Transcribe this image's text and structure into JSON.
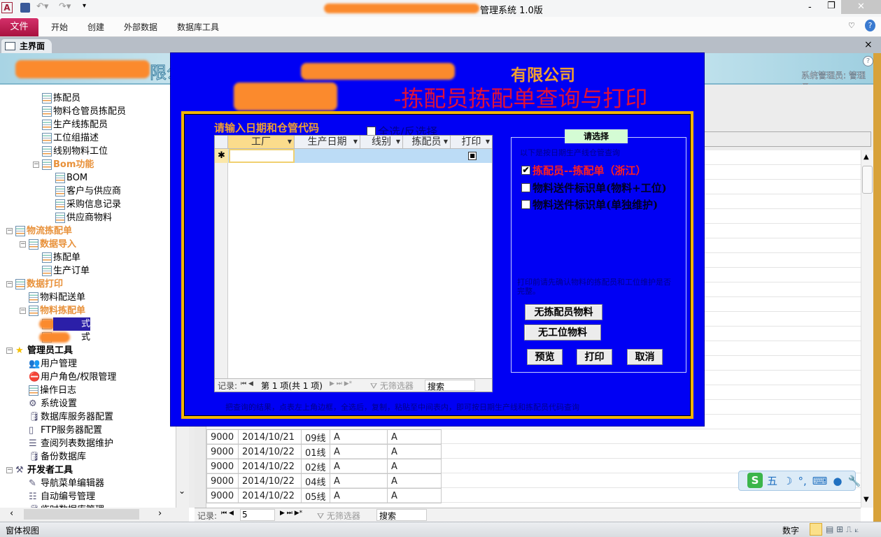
{
  "window": {
    "title": "管理系统 1.0版",
    "min": "-",
    "max": "❐",
    "close": "✕"
  },
  "ribbon": {
    "file": "文件",
    "tabs": [
      "开始",
      "创建",
      "外部数据",
      "数据库工具"
    ]
  },
  "doc_tab": {
    "label": "主界面",
    "close": "×"
  },
  "banner": {
    "company_suffix": "限公",
    "user": "系统管理员: 管理员"
  },
  "nav": [
    {
      "label": "拣配员",
      "level": 3
    },
    {
      "label": "物料仓管员拣配员",
      "level": 3
    },
    {
      "label": "生产线拣配员",
      "level": 3
    },
    {
      "label": "工位组描述",
      "level": 3
    },
    {
      "label": "线别物料工位",
      "level": 3
    },
    {
      "label": "Bom功能",
      "level": 3,
      "group": true
    },
    {
      "label": "BOM",
      "level": 4
    },
    {
      "label": "客户与供应商",
      "level": 4
    },
    {
      "label": "采购信息记录",
      "level": 4
    },
    {
      "label": "供应商物料",
      "level": 4
    },
    {
      "label": "物流拣配单",
      "level": 1,
      "group": true
    },
    {
      "label": "数据导入",
      "level": 2,
      "group": true
    },
    {
      "label": "拣配单",
      "level": 3
    },
    {
      "label": "生产订单",
      "level": 3
    },
    {
      "label": "数据打印",
      "level": 1,
      "group": true
    },
    {
      "label": "物料配送单",
      "level": 2
    },
    {
      "label": "物料拣配单",
      "level": 2,
      "group": true
    },
    {
      "label": "式",
      "level": 3,
      "selected": true,
      "redacted": true
    },
    {
      "label": "式",
      "level": 3,
      "redacted": true
    },
    {
      "label": "管理员工具",
      "level": 1,
      "bold": true,
      "icon": "star"
    },
    {
      "label": "用户管理",
      "level": 2,
      "icon": "users"
    },
    {
      "label": "用户角色/权限管理",
      "level": 2,
      "icon": "no-entry"
    },
    {
      "label": "操作日志",
      "level": 2
    },
    {
      "label": "系统设置",
      "level": 2,
      "icon": "settings"
    },
    {
      "label": "数据库服务器配置",
      "level": 2,
      "icon": "database"
    },
    {
      "label": "FTP服务器配置",
      "level": 2,
      "icon": "server"
    },
    {
      "label": "查阅列表数据维护",
      "level": 2,
      "icon": "list"
    },
    {
      "label": "备份数据库",
      "level": 2,
      "icon": "database"
    },
    {
      "label": "开发者工具",
      "level": 1,
      "bold": true,
      "icon": "tools"
    },
    {
      "label": "导航菜单编辑器",
      "level": 2,
      "icon": "edit"
    },
    {
      "label": "自动编号管理",
      "level": 2,
      "icon": "numbered-list"
    },
    {
      "label": "临时数据库管理",
      "level": 2,
      "icon": "database"
    }
  ],
  "background_grid": {
    "rows": [
      [
        "9000",
        "2014/10/21",
        "09线",
        "A",
        "A"
      ],
      [
        "9000",
        "2014/10/22",
        "01线",
        "A",
        "A"
      ],
      [
        "9000",
        "2014/10/22",
        "02线",
        "A",
        "A"
      ],
      [
        "9000",
        "2014/10/22",
        "04线",
        "A",
        "A"
      ],
      [
        "9000",
        "2014/10/22",
        "05线",
        "A",
        "A"
      ]
    ],
    "nav": {
      "label": "记录:",
      "current": "5",
      "filter": "无筛选器",
      "search": "搜索"
    }
  },
  "popup": {
    "company": "有限公司",
    "title": "-拣配员拣配单查询与打印",
    "prompt": "请输入日期和仓管代码",
    "select_all": "全选/反选择",
    "subform": {
      "columns": [
        "工厂",
        "生产日期",
        "线别",
        "拣配员",
        "打印"
      ],
      "new_row_marker": "✱",
      "nav": {
        "label": "记录:",
        "position": "第 1 项(共 1 项)",
        "filter": "无筛选器",
        "search": "搜索"
      }
    },
    "panel": {
      "title": "请选择",
      "hint": "以下是按日期生产线仓管查询",
      "options": [
        {
          "label": "拣配员--拣配单（浙江）",
          "checked": true,
          "color": "#ff2020"
        },
        {
          "label": "物料送件标识单(物料+工位)",
          "checked": false
        },
        {
          "label": "物料送件标识单(单独维护)",
          "checked": false
        }
      ],
      "note": "打印前请先确认物料的拣配员和工位维护是否完整。",
      "buttons": {
        "no_picker": "无拣配员物料",
        "no_station": "无工位物料",
        "preview": "预览",
        "print": "打印",
        "cancel": "取消"
      }
    },
    "footer": "把查询的结果，点表左上角边框，全选后，复制，粘贴至中间表内，即可按日期生产线和拣配员代码查询"
  },
  "ime": {
    "mode": "五"
  },
  "status": {
    "left": "窗体视图",
    "right": "数字"
  },
  "colors": {
    "popup_bg": "#0000f4",
    "frame": "#f0b400",
    "title_red": "#e0103a",
    "orange": "#f0a030",
    "file_tab": "#c0205a"
  }
}
